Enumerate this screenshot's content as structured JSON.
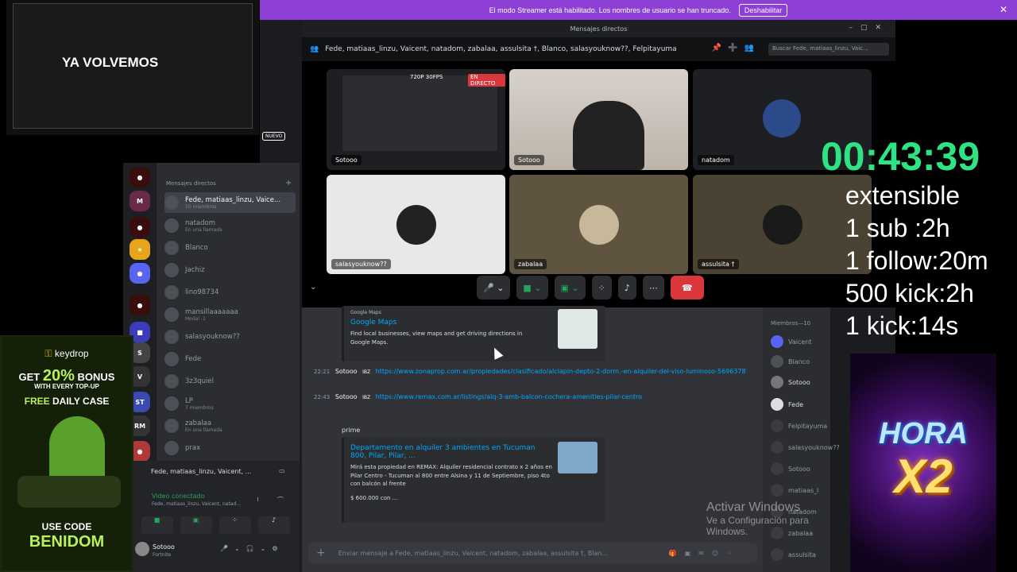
{
  "banner": {
    "text": "El modo Streamer está habilitado. Los nombres de usuario se han truncado.",
    "button": "Deshabilitar"
  },
  "titlebar": {
    "title": "Mensajes directos"
  },
  "call_header": {
    "participants": "Fede, matiaas_linzu, Vaicent, natadom, zabalaa, assulsita †, Blanco, salasyouknow??, Felpitayuma",
    "search_placeholder": "Buscar Fede, matiaas_linzu, Vaic..."
  },
  "tiles": [
    {
      "label": "Sotooo",
      "live": "EN DIRECTO",
      "fps": "720P 30FPS"
    },
    {
      "label": "Sotooo"
    },
    {
      "label": "natadom"
    },
    {
      "label": "salasyouknow??"
    },
    {
      "label": "zabalaa"
    },
    {
      "label": "assulsita †"
    }
  ],
  "chat": {
    "embed1": {
      "provider": "Google Maps",
      "title": "Google Maps",
      "desc": "Find local businesses, view maps and get driving directions in Google Maps."
    },
    "msg1": {
      "time": "22:21",
      "author": "Sotooo",
      "tag": "IBZ",
      "link": "https://www.zonaprop.com.ar/propiedades/clasificado/alclapin-depto-2-dorm.-en-alquiler-del-viso-luminoso-56963787.html?n_src=Listado&n_pill=Parrilla&n_pg=1&n_pos=1"
    },
    "msg2": {
      "time": "22:43",
      "author": "Sotooo",
      "tag": "IBZ",
      "link": "https://www.remax.com.ar/listings/alq-3-amb-balcon-cochera-amenities-pilar-centro"
    },
    "embed2": {
      "provider": "prime",
      "title": "Departamento en alquiler 3 ambientes en Tucuman 800, Pilar, Pilar, ...",
      "desc": "Mirá esta propiedad en REMAX: Alquiler residencial contrato x 2 años en Pilar Centro - Tucuman al 800 entre Alsina y 11 de Septiembre, piso 4to con balcón al frente",
      "price": "$ 600.000 con ..."
    },
    "composer_placeholder": "Enviar mensaje a Fede, matiaas_linzu, Vaicent, natadom, zabalaa, assulsita †, Blan..."
  },
  "members": {
    "header": "Miembros—10",
    "list": [
      "Vaicent",
      "Blanco",
      "Sotooo",
      "Fede",
      "Felpitayuma",
      "salasyouknow??",
      "Sotooo",
      "matiaas_l",
      "natadom",
      "zabalaa",
      "assulsita"
    ]
  },
  "dm_panel": {
    "header": "Mensajes directos",
    "items": [
      {
        "name": "Fede, matiaas_linzu, Vaice...",
        "sub": "10 miembros"
      },
      {
        "name": "natadom",
        "sub": "En una llamada"
      },
      {
        "name": "Blanco",
        "sub": ""
      },
      {
        "name": "Jachiz",
        "sub": ""
      },
      {
        "name": "lino98734",
        "sub": ""
      },
      {
        "name": "mansillaaaaaaa",
        "sub": "Modal -1"
      },
      {
        "name": "salasyouknow??",
        "sub": ""
      },
      {
        "name": "Fede",
        "sub": ""
      },
      {
        "name": "3z3quiel",
        "sub": ""
      },
      {
        "name": "LP",
        "sub": "7 miembros"
      },
      {
        "name": "zabalaa",
        "sub": "En una llamada"
      },
      {
        "name": "prax",
        "sub": ""
      }
    ]
  },
  "voice_panel": {
    "channel": "Fede, matiaas_linzu, Vaicent, ...",
    "status": "Video conectado",
    "status_sub": "Fede, matiaas_linzu, Vaicent, natad...",
    "user": "Sotooo",
    "user_sub": "Fortnite"
  },
  "overlays": {
    "brb": "YA VOLVEMOS",
    "nuevo": "NUEVO",
    "timer": "00:43:39",
    "info": [
      "extensible",
      "1 sub :2h",
      "1 follow:20m",
      "500 kick:2h",
      "1 kick:14s"
    ],
    "ad": {
      "logo": "keydrop",
      "get": "GET",
      "pct": "20%",
      "bonus": "BONUS",
      "with": "WITH EVERY TOP-UP",
      "free_a": "FREE",
      "free_b": "DAILY CASE",
      "use": "USE CODE",
      "code": "BENIDOM"
    },
    "hora": {
      "line1": "HORA",
      "line2": "X2"
    },
    "watermark": {
      "line1": "Activar Windows",
      "line2": "Ve a Configuración para",
      "line3": "Windows."
    }
  },
  "colors": {
    "accent": "#8e3fd6",
    "timer": "#2de383",
    "discord_bg": "#313338",
    "danger": "#da373c"
  }
}
